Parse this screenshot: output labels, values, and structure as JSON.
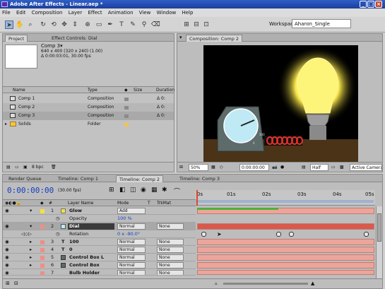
{
  "app": {
    "title": "Adobe After Effects - Linear.aep *"
  },
  "menu": [
    "File",
    "Edit",
    "Composition",
    "Layer",
    "Effect",
    "Animation",
    "View",
    "Window",
    "Help"
  ],
  "toolbar": {
    "workspace_label": "Workspace:",
    "workspace_value": "Aharon_Single"
  },
  "project": {
    "tabs": [
      "Project",
      "Effect Controls: Dial"
    ],
    "selected_name": "Comp 3▾",
    "info_line1": "640 x 400 (320 x 240) (1.00)",
    "info_line2": "Δ 0:00:03:01, 30.00 fps",
    "columns": [
      "Name",
      "Type",
      "Size",
      "Duration"
    ],
    "items": [
      {
        "name": "Comp 1",
        "type": "Composition",
        "dur": "Δ 0:"
      },
      {
        "name": "Comp 2",
        "type": "Composition",
        "dur": "Δ 0:"
      },
      {
        "name": "Comp 3",
        "type": "Composition",
        "dur": "Δ 0:"
      },
      {
        "name": "Solids",
        "type": "Folder",
        "dur": ""
      }
    ],
    "bpc": "8 bpc"
  },
  "comp": {
    "tab": "Composition: Comp 2",
    "zoom": "50%",
    "time": "0:00:00:00",
    "res": "Half",
    "camera": "Active Camera"
  },
  "timeline": {
    "tabs": [
      "Render Queue",
      "Timeline: Comp 1",
      "Timeline: Comp 2",
      "Timeline: Comp 3"
    ],
    "timecode": "0:00:00:00",
    "fps": "(30.00 fps)",
    "columns": [
      "#",
      "Layer Name",
      "Mode",
      "T",
      "TrkMat"
    ],
    "ruler_marks": [
      "0s",
      "01s",
      "02s",
      "03s",
      "04s",
      "05s"
    ],
    "layers": [
      {
        "num": "1",
        "name": "Glow",
        "mode": "Add",
        "trk": "",
        "color": "#f3e23b",
        "kind": "solid"
      },
      {
        "num": "",
        "name": "Opacity",
        "mode": "100 %",
        "trk": "",
        "color": "",
        "kind": "prop"
      },
      {
        "num": "2",
        "name": "Dial",
        "mode": "Normal",
        "trk": "None",
        "color": "#f08e85",
        "kind": "layer"
      },
      {
        "num": "",
        "name": "Rotation",
        "mode": "0 x -90.0°",
        "trk": "",
        "color": "",
        "kind": "prop"
      },
      {
        "num": "3",
        "name": "100",
        "mode": "Normal",
        "trk": "None",
        "color": "#f08e85",
        "kind": "text"
      },
      {
        "num": "4",
        "name": "0",
        "mode": "Normal",
        "trk": "None",
        "color": "#f08e85",
        "kind": "text"
      },
      {
        "num": "5",
        "name": "Control Box L",
        "mode": "Normal",
        "trk": "None",
        "color": "#f08e85",
        "kind": "layer"
      },
      {
        "num": "6",
        "name": "Control Box",
        "mode": "Normal",
        "trk": "None",
        "color": "#f08e85",
        "kind": "layer"
      },
      {
        "num": "7",
        "name": "Bulb Holder",
        "mode": "Normal",
        "trk": "None",
        "color": "#f08e85",
        "kind": "layer"
      }
    ]
  }
}
